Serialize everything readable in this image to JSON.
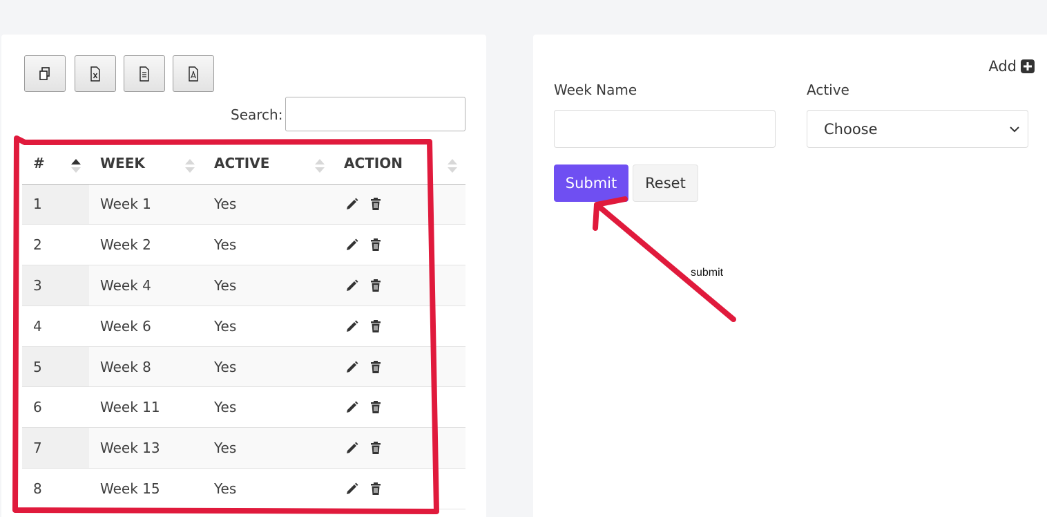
{
  "toolbar": {
    "buttons": [
      {
        "name": "copy",
        "icon": "copy-icon"
      },
      {
        "name": "excel",
        "icon": "excel-file-icon"
      },
      {
        "name": "csv",
        "icon": "csv-file-icon"
      },
      {
        "name": "pdf",
        "icon": "pdf-file-icon"
      }
    ]
  },
  "search": {
    "label": "Search:",
    "value": ""
  },
  "table": {
    "headers": [
      "#",
      "WEEK",
      "ACTIVE",
      "ACTION"
    ],
    "rows": [
      {
        "num": "1",
        "week": "Week 1",
        "active": "Yes"
      },
      {
        "num": "2",
        "week": "Week 2",
        "active": "Yes"
      },
      {
        "num": "3",
        "week": "Week 4",
        "active": "Yes"
      },
      {
        "num": "4",
        "week": "Week 6",
        "active": "Yes"
      },
      {
        "num": "5",
        "week": "Week 8",
        "active": "Yes"
      },
      {
        "num": "6",
        "week": "Week 11",
        "active": "Yes"
      },
      {
        "num": "7",
        "week": "Week 13",
        "active": "Yes"
      },
      {
        "num": "8",
        "week": "Week 15",
        "active": "Yes"
      }
    ]
  },
  "form": {
    "add_label": "Add",
    "week_name_label": "Week Name",
    "week_name_value": "",
    "active_label": "Active",
    "active_selected": "Choose",
    "submit_label": "Submit",
    "reset_label": "Reset"
  },
  "annotation": {
    "text": "submit",
    "color": "#e01a3c"
  },
  "colors": {
    "accent": "#6f4ff2",
    "annotation": "#e01a3c"
  }
}
